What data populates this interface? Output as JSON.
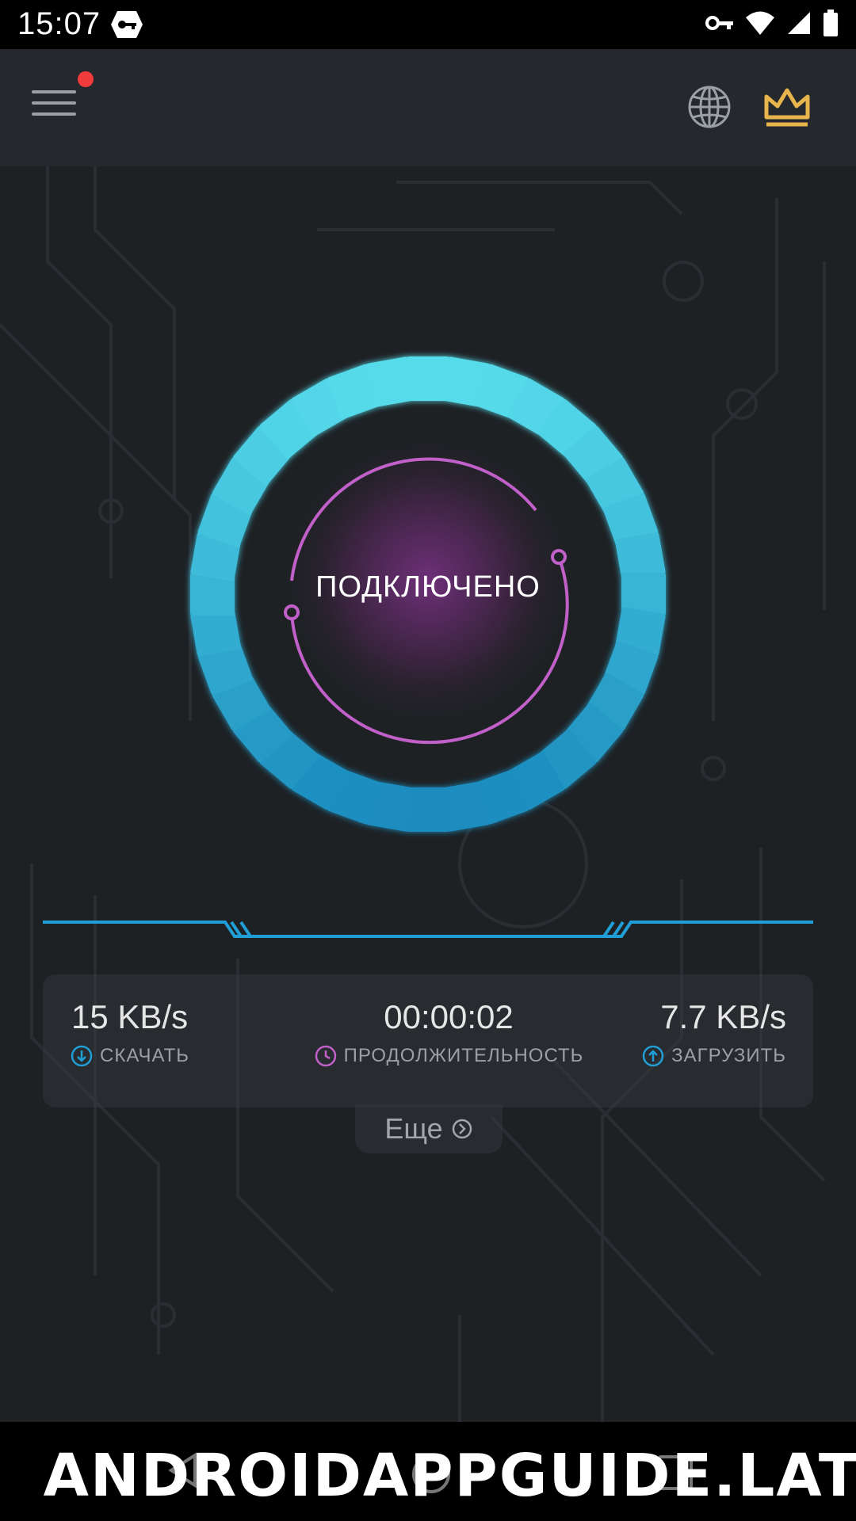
{
  "status_bar": {
    "time": "15:07"
  },
  "connection": {
    "status": "ПОДКЛЮЧЕНО"
  },
  "stats": {
    "download": {
      "value": "15 KB/s",
      "label": "СКАЧАТЬ"
    },
    "duration": {
      "value": "00:00:02",
      "label": "ПРОДОЛЖИТЕЛЬНОСТЬ"
    },
    "upload": {
      "value": "7.7 KB/s",
      "label": "ЗАГРУЗИТЬ"
    }
  },
  "more_label": "Еще",
  "watermark": "ANDROIDAPPGUIDE.LAT",
  "colors": {
    "accent_blue": "#2fb3e0",
    "accent_purple": "#c060c8",
    "crown_gold": "#e8b44c",
    "notification_red": "#f23b3b"
  }
}
